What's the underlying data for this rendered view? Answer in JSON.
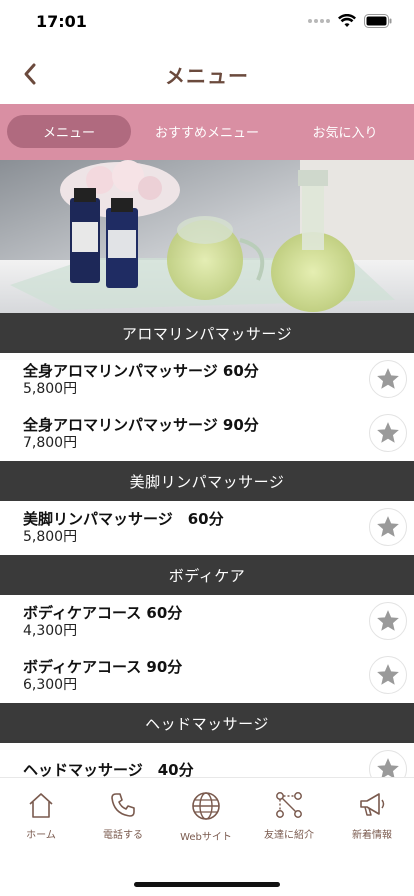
{
  "status_bar": {
    "time": "17:01"
  },
  "nav": {
    "title": "メニュー"
  },
  "tabs": [
    {
      "label": "メニュー",
      "active": true
    },
    {
      "label": "おすすめメニュー",
      "active": false
    },
    {
      "label": "お気に入り",
      "active": false
    }
  ],
  "sections": [
    {
      "title": "アロマリンパマッサージ",
      "items": [
        {
          "name": "全身アロマリンパマッサージ 60分",
          "price": "5,800円"
        },
        {
          "name": "全身アロマリンパマッサージ 90分",
          "price": "7,800円"
        }
      ]
    },
    {
      "title": "美脚リンパマッサージ",
      "items": [
        {
          "name": "美脚リンパマッサージ　60分",
          "price": "5,800円"
        }
      ]
    },
    {
      "title": "ボディケア",
      "items": [
        {
          "name": "ボディケアコース 60分",
          "price": "4,300円"
        },
        {
          "name": "ボディケアコース 90分",
          "price": "6,300円"
        }
      ]
    },
    {
      "title": "ヘッドマッサージ",
      "items": [
        {
          "name": "ヘッドマッサージ　40分",
          "price": ""
        }
      ]
    }
  ],
  "bottom_nav": [
    {
      "label": "ホーム",
      "icon": "home-icon"
    },
    {
      "label": "電話する",
      "icon": "phone-icon"
    },
    {
      "label": "Webサイト",
      "icon": "globe-icon"
    },
    {
      "label": "友達に紹介",
      "icon": "share-icon"
    },
    {
      "label": "新着情報",
      "icon": "megaphone-icon"
    }
  ],
  "colors": {
    "accent": "#d98fa3",
    "active_tab": "#b06a7f",
    "brown": "#6b4a3d",
    "section_bg": "#3a3a3a",
    "star": "#9a9a9a"
  }
}
